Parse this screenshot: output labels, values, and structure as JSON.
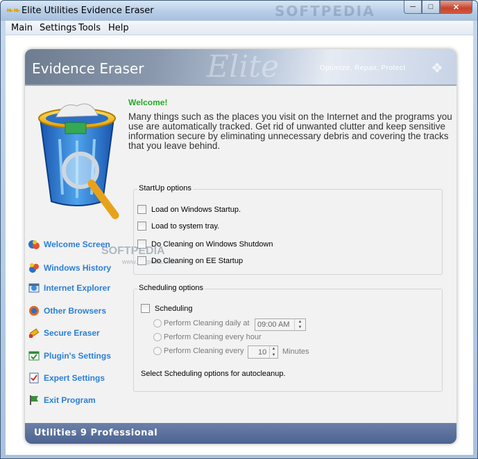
{
  "window": {
    "title": "Elite Utilities Evidence Eraser",
    "watermark": "SOFTPEDIA"
  },
  "menu": [
    "Main",
    "Settings",
    "Tools",
    "Help"
  ],
  "header": {
    "title": "Evidence Eraser",
    "logo_text": "Elite",
    "tagline": "Optimize, Repair, Protect"
  },
  "welcome": {
    "title": "Welcome!",
    "body": "Many things such as the places you visit on the Internet and the programs you use are automatically tracked. Get rid of unwanted clutter and keep sensitive information secure by eliminating unnecessary debris and covering the tracks that you leave behind."
  },
  "nav": [
    {
      "label": "Welcome Screen",
      "icon": "welcome-icon"
    },
    {
      "label": "Windows History",
      "icon": "windows-history-icon"
    },
    {
      "label": "Internet Explorer",
      "icon": "internet-explorer-icon"
    },
    {
      "label": "Other Browsers",
      "icon": "other-browsers-icon"
    },
    {
      "label": "Secure Eraser",
      "icon": "secure-eraser-icon"
    },
    {
      "label": "Plugin's Settings",
      "icon": "plugin-settings-icon"
    },
    {
      "label": "Expert Settings",
      "icon": "expert-settings-icon"
    },
    {
      "label": "Exit Program",
      "icon": "exit-flag-icon"
    }
  ],
  "startup": {
    "title": "StartUp options",
    "options": [
      {
        "label": "Load on Windows Startup.",
        "checked": false
      },
      {
        "label": "Load to system tray.",
        "checked": false
      },
      {
        "label": "Do Cleaning on Windows Shutdown",
        "checked": false
      },
      {
        "label": "Do Cleaning on EE Startup",
        "checked": false
      }
    ]
  },
  "scheduling": {
    "title": "Scheduling options",
    "enable_label": "Scheduling",
    "daily_label": "Perform Cleaning daily at",
    "daily_time": "09:00 AM",
    "hourly_label": "Perform Cleaning every hour",
    "every_label": "Perform Cleaning every",
    "every_value": "10",
    "every_unit": "Minutes",
    "note": "Select Scheduling options for autocleanup."
  },
  "footer": {
    "text": "Utilities 9 Professional"
  },
  "softpedia_overlay": {
    "big": "SOFTPEDIA",
    "url": "www.softpedia.com"
  }
}
